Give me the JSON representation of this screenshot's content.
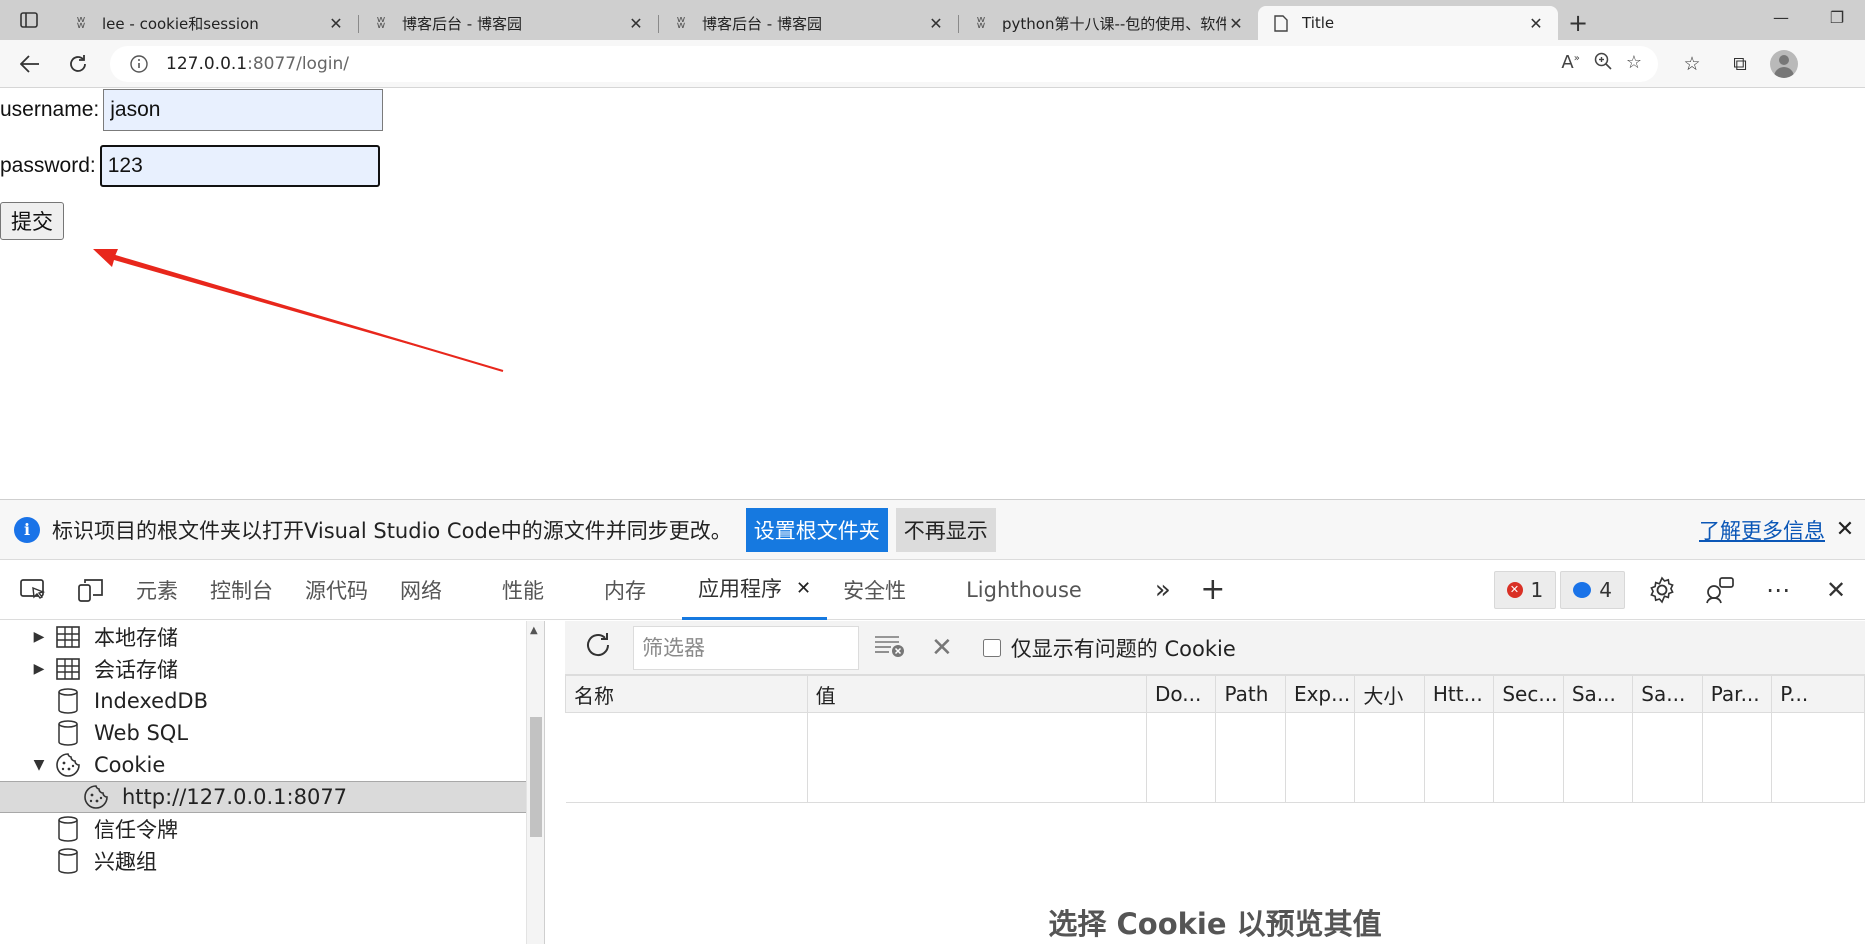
{
  "browser": {
    "tabs": [
      {
        "title": "lee - cookie和session"
      },
      {
        "title": "博客后台 - 博客园"
      },
      {
        "title": "博客后台 - 博客园"
      },
      {
        "title": "python第十八课--包的使用、软件"
      },
      {
        "title": "Title"
      }
    ],
    "address": {
      "host": "127.0.0.1",
      "path": ":8077/login/"
    }
  },
  "page": {
    "username_label": "username:",
    "username_value": "jason",
    "password_label": "password:",
    "password_value": "123",
    "submit_label": "提交"
  },
  "devtools": {
    "infobar": {
      "message": "标识项目的根文件夹以打开Visual Studio Code中的源文件并同步更改。",
      "primary_button": "设置根文件夹",
      "secondary_button": "不再显示",
      "link": "了解更多信息"
    },
    "tabs": [
      "元素",
      "控制台",
      "源代码",
      "网络",
      "性能",
      "内存",
      "应用程序",
      "安全性",
      "Lighthouse"
    ],
    "active_tab": "应用程序",
    "error_count": "1",
    "message_count": "4",
    "sidebar": [
      {
        "label": "本地存储",
        "icon": "table-icon"
      },
      {
        "label": "会话存储",
        "icon": "table-icon"
      },
      {
        "label": "IndexedDB",
        "icon": "database-icon"
      },
      {
        "label": "Web SQL",
        "icon": "database-icon"
      },
      {
        "label": "Cookie",
        "icon": "cookie-icon"
      },
      {
        "label": "http://127.0.0.1:8077",
        "icon": "cookie-icon"
      },
      {
        "label": "信任令牌",
        "icon": "database-icon"
      },
      {
        "label": "兴趣组",
        "icon": "database-icon"
      }
    ],
    "cookies": {
      "filter_placeholder": "筛选器",
      "issues_only_label": "仅显示有问题的 Cookie",
      "columns": [
        "名称",
        "值",
        "Do...",
        "Path",
        "Exp...",
        "大小",
        "Htt...",
        "Sec...",
        "Sa...",
        "Sa...",
        "Par...",
        "P..."
      ],
      "preview_message": "选择 Cookie 以预览其值"
    }
  },
  "colors": {
    "accent": "#1679e0",
    "annotation_arrow": "#e8271c"
  }
}
